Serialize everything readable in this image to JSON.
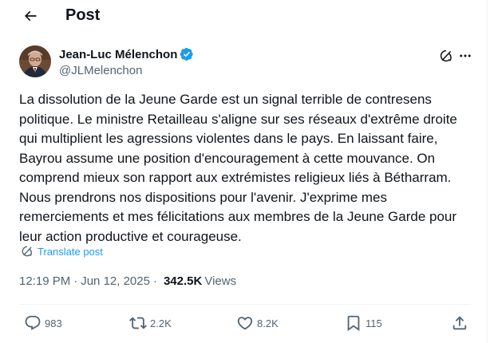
{
  "header": {
    "title": "Post"
  },
  "author": {
    "display_name": "Jean-Luc Mélenchon",
    "handle": "@JLMelenchon",
    "verified_color": "#1d9bf0"
  },
  "tweet": {
    "text": "La dissolution de la Jeune Garde est un signal terrible de contresens\npolitique. Le ministre Retailleau s'aligne sur ses réseaux d'extrême droite\nqui multiplient les agressions violentes dans le pays. En laissant faire,\nBayrou assume une position d'encouragement à cette mouvance. On\ncomprend mieux son rapport aux extrémistes religieux liés à Bétharram.\nNous prendrons nos dispositions pour l'avenir. J'exprime mes\nremerciements et mes félicitations aux membres de la Jeune Garde pour\nleur action productive et courageuse.",
    "translate_label": "Translate post",
    "time": "12:19 PM",
    "date": "Jun 12, 2025",
    "separator": "·",
    "views_count": "342.5K",
    "views_label": "Views"
  },
  "actions": {
    "replies": "983",
    "reposts": "2.2K",
    "likes": "8.2K",
    "bookmarks": "115"
  },
  "icons": [
    "back-arrow-icon",
    "verified-badge-icon",
    "grok-icon",
    "more-icon",
    "translate-icon",
    "reply-icon",
    "repost-icon",
    "like-icon",
    "bookmark-icon",
    "share-icon"
  ],
  "colors": {
    "text": "#0f1419",
    "secondary": "#536471",
    "accent": "#1d9bf0",
    "divider": "#eff3f4"
  }
}
